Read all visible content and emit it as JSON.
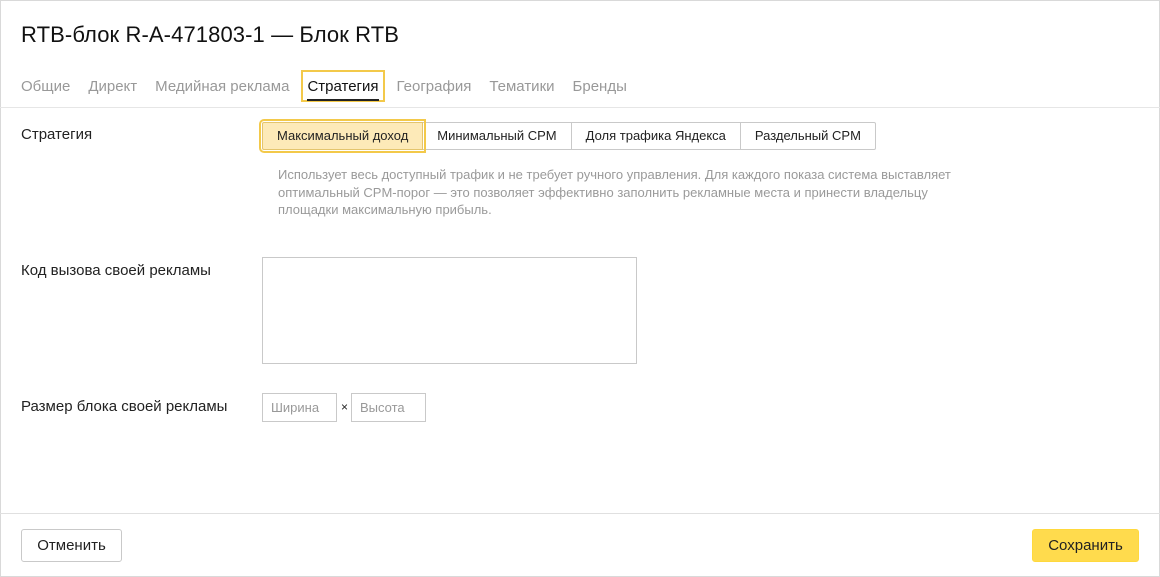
{
  "dialog": {
    "title": "RTB-блок R-A-471803-1 — Блок RTB"
  },
  "tabs": [
    {
      "label": "Общие"
    },
    {
      "label": "Директ"
    },
    {
      "label": "Медийная реклама"
    },
    {
      "label": "Стратегия",
      "active": true
    },
    {
      "label": "География"
    },
    {
      "label": "Тематики"
    },
    {
      "label": "Бренды"
    }
  ],
  "strategy": {
    "label": "Стратегия",
    "options": [
      {
        "label": "Максимальный доход",
        "selected": true
      },
      {
        "label": "Минимальный CPM"
      },
      {
        "label": "Доля трафика Яндекса"
      },
      {
        "label": "Раздельный CPM"
      }
    ],
    "description": "Использует весь доступный трафик и не требует ручного управления. Для каждого показа система выставляет оптимальный CPM-порог — это позволяет эффективно заполнить рекламные места и принести владельцу площадки максимальную прибыль."
  },
  "own_ad_code": {
    "label": "Код вызова своей рекламы",
    "value": ""
  },
  "own_ad_size": {
    "label": "Размер блока своей рекламы",
    "width_placeholder": "Ширина",
    "height_placeholder": "Высота",
    "separator": "×"
  },
  "footer": {
    "cancel_label": "Отменить",
    "save_label": "Сохранить"
  },
  "colors": {
    "accent": "#ffdb4d",
    "focus_outline": "#f3c94a",
    "selected_segment": "#fdeab8"
  }
}
